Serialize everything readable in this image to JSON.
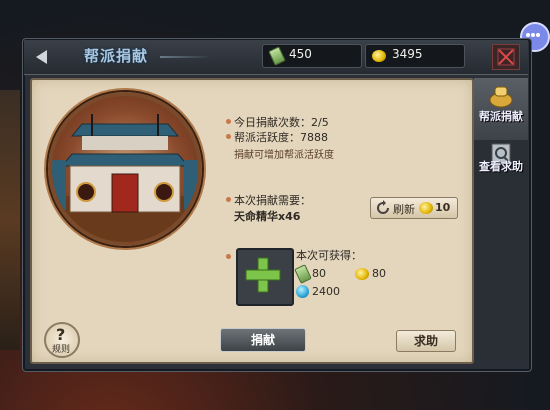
{
  "header": {
    "title": "帮派捐献",
    "jade": "450",
    "gold": "3495"
  },
  "side_tabs": [
    {
      "label": "帮派捐献"
    },
    {
      "label": "查看求助"
    }
  ],
  "info": {
    "count_label": "今日捐献次数：2/5",
    "activity_label": "帮派活跃度：7888",
    "hint": "捐献可增加帮派活跃度"
  },
  "cost": {
    "title": "本次捐献需要：",
    "item": "天命精华x46"
  },
  "refresh": {
    "label": "刷新",
    "cost": "10"
  },
  "reward": {
    "title": "本次可获得：",
    "jade": "80",
    "gold": "80",
    "gem": "2400"
  },
  "buttons": {
    "donate": "捐献",
    "help": "求助",
    "rules": "规则"
  },
  "colors": {
    "panel": "#e3d6bd",
    "accent_text": "#2f2a24",
    "title": "#aac8e2"
  }
}
